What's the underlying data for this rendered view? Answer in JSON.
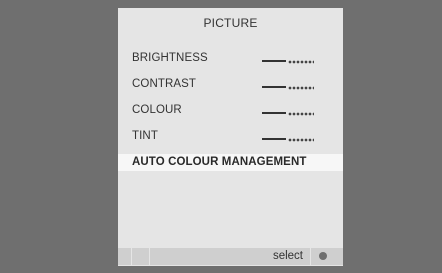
{
  "menu": {
    "title": "PICTURE",
    "items": [
      {
        "label": "BRIGHTNESS",
        "level": 0.5
      },
      {
        "label": "CONTRAST",
        "level": 0.5
      },
      {
        "label": "COLOUR",
        "level": 0.5
      },
      {
        "label": "TINT",
        "level": 0.5
      },
      {
        "label": "AUTO COLOUR MANAGEMENT",
        "selected": true
      }
    ]
  },
  "footer": {
    "select_label": "select",
    "button_icon": "dot-icon"
  },
  "colors": {
    "background": "#707070",
    "panel": "#e5e5e5",
    "selected_row": "#f7f7f7",
    "footer_bar": "#cfcfcf"
  }
}
